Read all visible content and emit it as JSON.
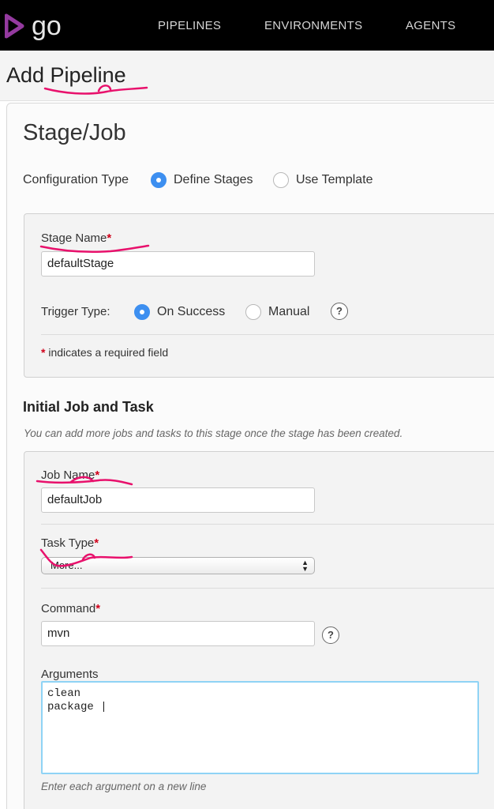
{
  "nav": {
    "logo_text": "go",
    "links": [
      "PIPELINES",
      "ENVIRONMENTS",
      "AGENTS"
    ]
  },
  "header": {
    "title": "Add Pipeline"
  },
  "stage_job": {
    "title": "Stage/Job",
    "config_type_label": "Configuration Type",
    "config_options": [
      "Define Stages",
      "Use Template"
    ],
    "config_selected": "Define Stages",
    "stage_name_label": "Stage Name",
    "stage_name_value": "defaultStage",
    "trigger_type_label": "Trigger Type:",
    "trigger_options": [
      "On Success",
      "Manual"
    ],
    "trigger_selected": "On Success",
    "help_glyph": "?",
    "required_marker": "*",
    "required_note": "indicates a required field"
  },
  "initial_job": {
    "title": "Initial Job and Task",
    "hint": "You can add more jobs and tasks to this stage once the stage has been created.",
    "job_name_label": "Job Name",
    "job_name_value": "defaultJob",
    "task_type_label": "Task Type",
    "task_type_value": "More...",
    "command_label": "Command",
    "command_value": "mvn",
    "arguments_label": "Arguments",
    "arguments_value": "clean\npackage |",
    "arguments_hint": "Enter each argument on a new line"
  },
  "colors": {
    "nav_bg": "#000000",
    "accent_radio": "#3d8ff0",
    "logo_purple": "#943a9f",
    "annotation_pink": "#e8116c",
    "required_red": "#d0021b"
  },
  "icons": {
    "logo": "go-logo-icon",
    "help": "help-icon",
    "select_arrows": "updown-arrows-icon"
  }
}
